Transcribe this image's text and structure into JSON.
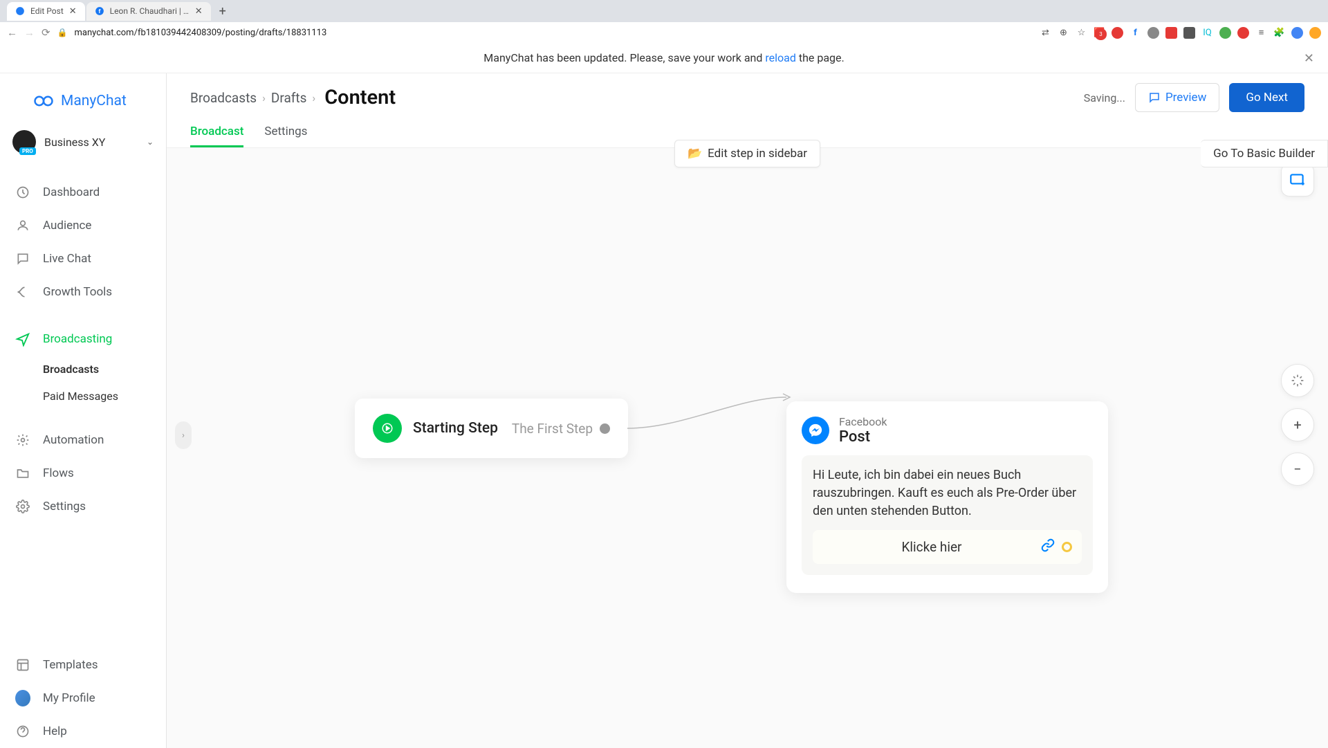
{
  "browser": {
    "tabs": [
      "Edit Post",
      "Leon R. Chaudhari | Facebook"
    ],
    "url": "manychat.com/fb181039442408309/posting/drafts/18831113"
  },
  "banner": {
    "pre": "ManyChat has been updated. Please, save your work and ",
    "link": "reload",
    "post": " the page."
  },
  "brand": "ManyChat",
  "workspace": {
    "name": "Business XY",
    "badge": "PRO"
  },
  "nav": {
    "dashboard": "Dashboard",
    "audience": "Audience",
    "livechat": "Live Chat",
    "growth": "Growth Tools",
    "broadcasting": "Broadcasting",
    "broadcasts": "Broadcasts",
    "paid": "Paid Messages",
    "automation": "Automation",
    "flows": "Flows",
    "settings": "Settings",
    "templates": "Templates",
    "profile": "My Profile",
    "help": "Help"
  },
  "header": {
    "bc1": "Broadcasts",
    "bc2": "Drafts",
    "title": "Content",
    "saving": "Saving...",
    "preview": "Preview",
    "next": "Go Next"
  },
  "tabs": {
    "broadcast": "Broadcast",
    "settings": "Settings"
  },
  "toolbar": {
    "edit_sidebar": "Edit step in sidebar",
    "basic": "Go To Basic Builder"
  },
  "start_node": {
    "title": "Starting Step",
    "sub": "The First Step"
  },
  "post_node": {
    "platform": "Facebook",
    "type": "Post",
    "text": "Hi Leute, ich bin dabei ein neues Buch rauszubringen. Kauft es euch als Pre-Order über den unten stehenden Button.",
    "cta": "Klicke hier"
  }
}
